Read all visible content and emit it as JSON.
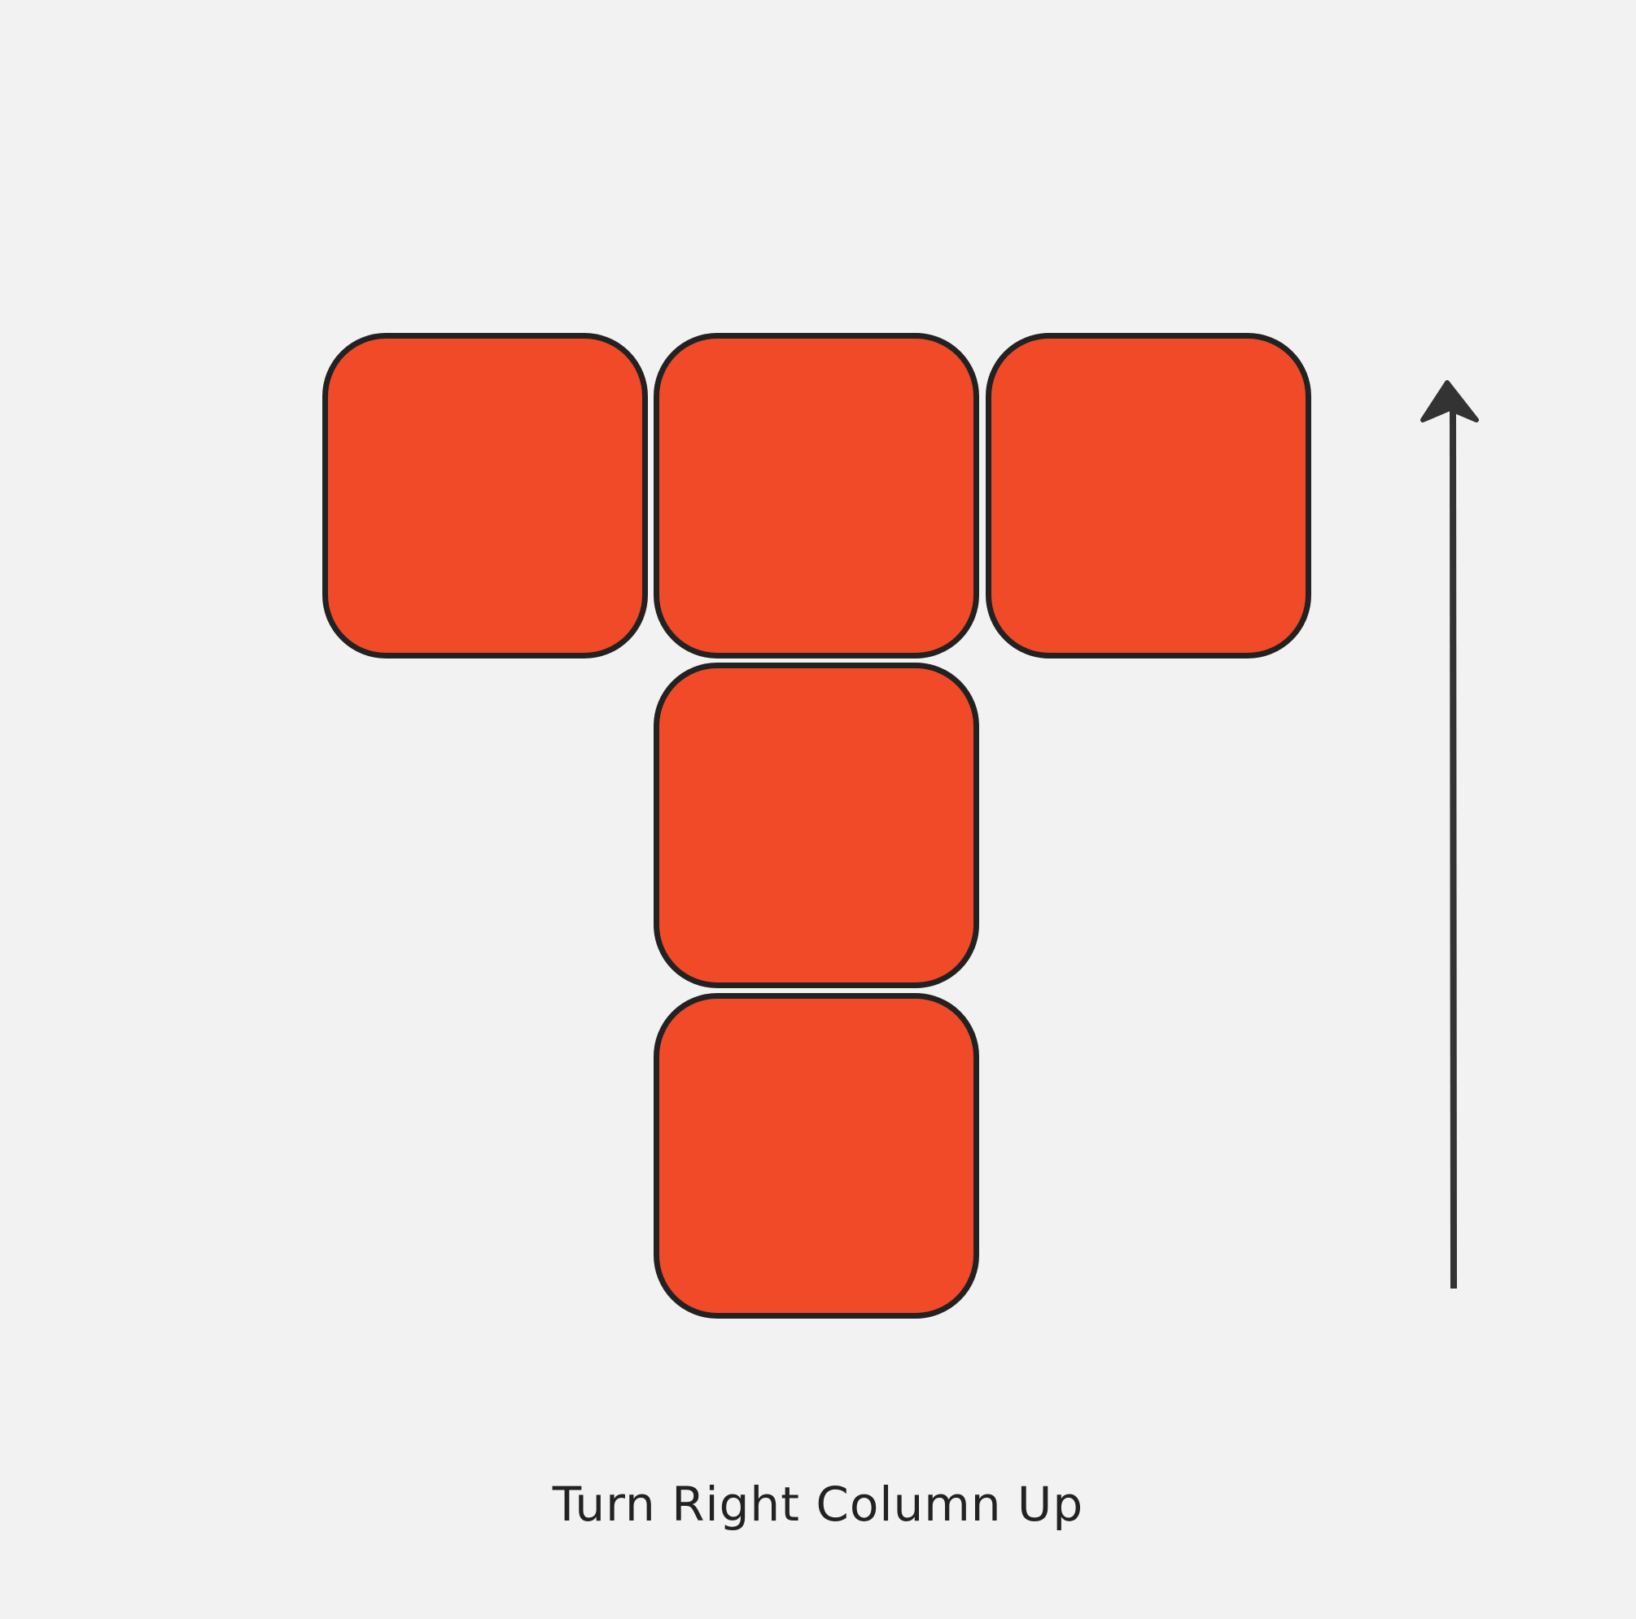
{
  "puzzle": {
    "tile_color": "#f04a28",
    "outline_color": "#222222",
    "background_color": "#f2f2f2",
    "cells": [
      {
        "row": 0,
        "col": 0
      },
      {
        "row": 0,
        "col": 1
      },
      {
        "row": 0,
        "col": 2
      },
      {
        "row": 1,
        "col": 1
      },
      {
        "row": 2,
        "col": 1
      }
    ]
  },
  "arrow": {
    "direction": "up",
    "icon": "arrow-up-icon",
    "color": "#333333"
  },
  "caption": {
    "text": "Turn Right Column Up"
  }
}
